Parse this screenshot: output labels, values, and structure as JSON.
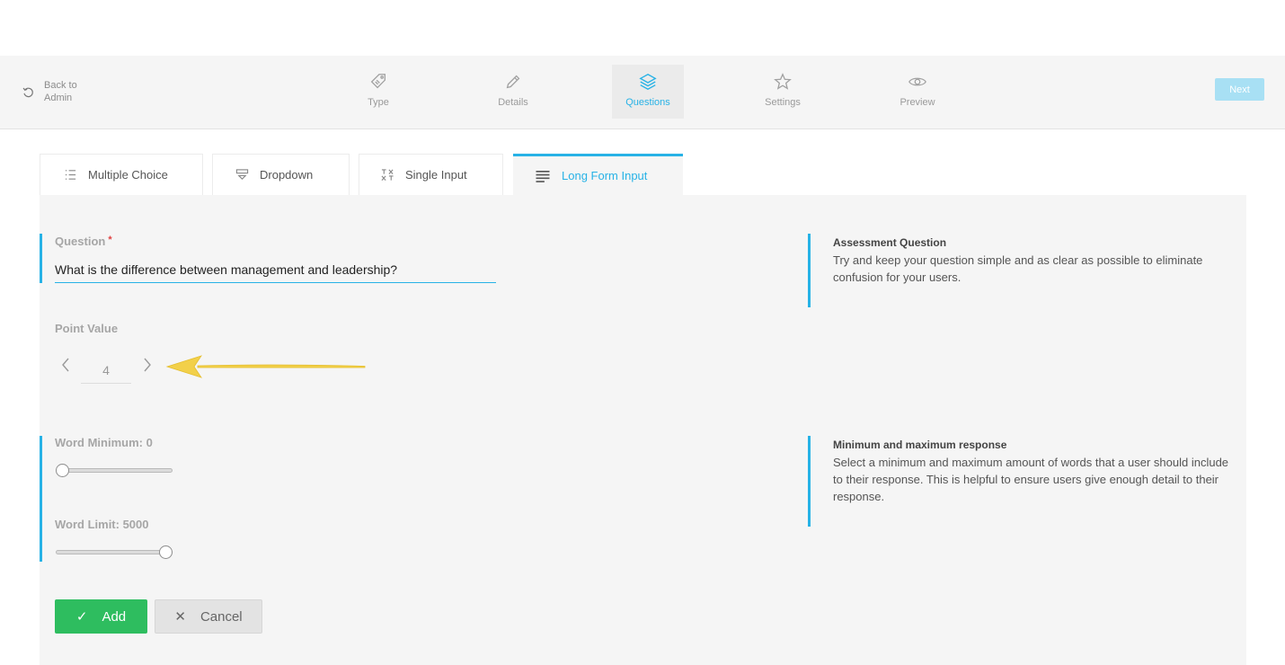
{
  "header": {
    "back_label": "Back to Admin",
    "next_label": "Next",
    "steps": [
      {
        "label": "Type",
        "icon": "tag-icon"
      },
      {
        "label": "Details",
        "icon": "pencil-icon"
      },
      {
        "label": "Questions",
        "icon": "layers-icon",
        "active": true
      },
      {
        "label": "Settings",
        "icon": "star-icon"
      },
      {
        "label": "Preview",
        "icon": "eye-icon"
      }
    ]
  },
  "tabs": [
    {
      "label": "Multiple Choice",
      "icon": "list-icon"
    },
    {
      "label": "Dropdown",
      "icon": "dropdown-icon"
    },
    {
      "label": "Single Input",
      "icon": "text-input-icon"
    },
    {
      "label": "Long Form Input",
      "icon": "paragraph-icon",
      "active": true
    }
  ],
  "form": {
    "question_label": "Question",
    "required_mark": "*",
    "question_value": "What is the difference between management and leadership?",
    "point_value_label": "Point Value",
    "point_value": "4",
    "word_min_label": "Word Minimum: 0",
    "word_min_value": 0,
    "word_limit_label": "Word Limit: 5000",
    "word_limit_value": 5000,
    "slider_max": 5000,
    "add_label": "Add",
    "cancel_label": "Cancel"
  },
  "help": {
    "question_title": "Assessment Question",
    "question_desc": "Try and keep your question simple and as clear as possible to eliminate confusion for your users.",
    "minmax_title": "Minimum and maximum response",
    "minmax_desc": "Select a minimum and maximum amount of words that a user should include to their response. This is helpful to ensure users give enough detail to their response."
  },
  "colors": {
    "accent": "#27b2e6",
    "add_button": "#2ebd5f",
    "annotation_arrow": "#f2d04a"
  }
}
